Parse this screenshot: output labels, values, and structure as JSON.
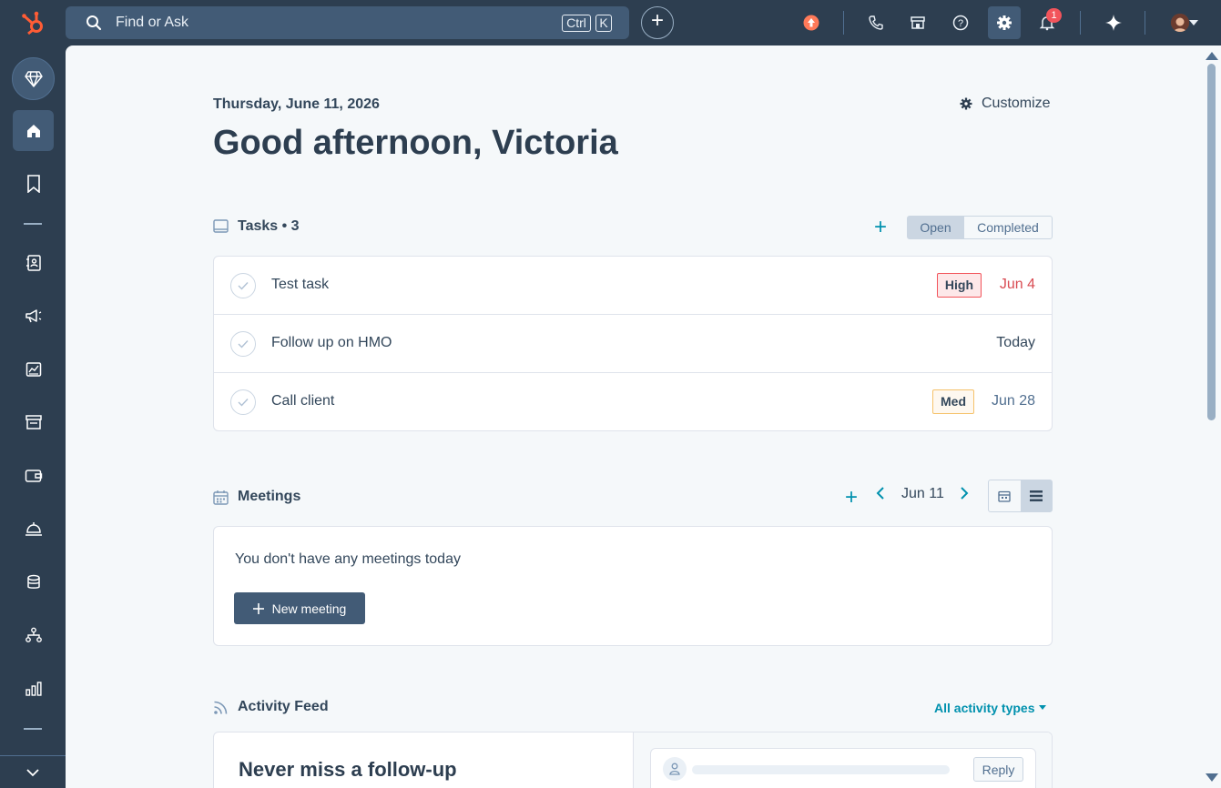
{
  "topbar": {
    "search_placeholder": "Find or Ask",
    "kbd_ctrl": "Ctrl",
    "kbd_k": "K",
    "notification_count": "1",
    "icons": [
      "upgrade-icon",
      "phone-icon",
      "marketplace-icon",
      "help-icon",
      "settings-icon",
      "notifications-icon",
      "ai-sparkle-icon",
      "avatar"
    ]
  },
  "sidebar": {
    "items": [
      "gem-icon",
      "home-icon",
      "bookmark-icon",
      "contacts-icon",
      "marketing-icon",
      "reports-icon",
      "commerce-icon",
      "payments-icon",
      "service-icon",
      "data-icon",
      "automation-icon",
      "analytics-icon",
      "expand-icon"
    ]
  },
  "page": {
    "date": "Thursday, June 11, 2026",
    "greeting": "Good afternoon, Victoria",
    "customize_label": "Customize"
  },
  "tasks": {
    "heading": "Tasks • 3",
    "toggle_open": "Open",
    "toggle_completed": "Completed",
    "rows": [
      {
        "title": "Test task",
        "priority": "High",
        "due": "Jun 4",
        "due_color": "#d94c53"
      },
      {
        "title": "Follow up on HMO",
        "priority": "",
        "due": "Today",
        "due_color": "#33475b"
      },
      {
        "title": "Call client",
        "priority": "Med",
        "due": "Jun 28",
        "due_color": "#516f90"
      }
    ]
  },
  "meetings": {
    "heading": "Meetings",
    "date_label": "Jun 11",
    "empty_text": "You don't have any meetings today",
    "new_meeting_label": "New meeting"
  },
  "activity": {
    "heading": "Activity Feed",
    "filter_label": "All activity types",
    "promo_heading": "Never miss a follow-up",
    "reply_label": "Reply"
  },
  "colors": {
    "accent": "#0091ae",
    "brand": "#ff5c35",
    "nav_bg": "#2d3e50",
    "content_bg": "#f5f8fa"
  }
}
